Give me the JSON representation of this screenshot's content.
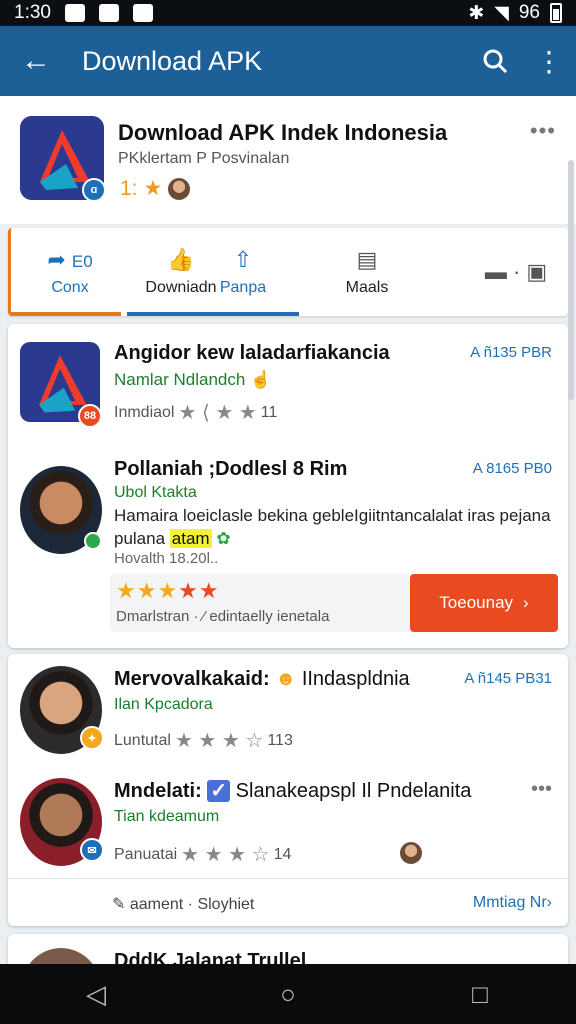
{
  "status": {
    "time": "1:30",
    "battery": "96"
  },
  "appbar": {
    "title": "Download APK"
  },
  "app": {
    "name": "Download APK Indek Indonesia",
    "subtitle": "PKklertam P Posvinalan",
    "rating": "1:",
    "more": "•••"
  },
  "tabs": [
    {
      "icon": "⇢ ⬳",
      "label_top": "E0",
      "label": "Conx"
    },
    {
      "icon": "👍",
      "label": "Downiadn"
    },
    {
      "icon": "⇧",
      "label": "Panpa"
    },
    {
      "icon": "▤",
      "label": "Maals"
    },
    {
      "icon": "▬ · ▣",
      "label": ""
    }
  ],
  "card1": {
    "item1": {
      "title": "Angidor kew laladarfiakancia",
      "sub": "Namlar Ndlandch",
      "meta": "Inmdiaol",
      "count": "11",
      "price": "A ñ135 PBR"
    },
    "item2": {
      "title": "Pollaniah ;Dodlesl 8 Rim",
      "sub": "Ubol Ktakta",
      "body": "Hamaira loeiclasle bekina gebleIgiitntancalalat iras pejana pulana",
      "highlight": "atam",
      "timestamp": "Hovalth 18.20l..",
      "price": "A 8165 PB0",
      "stars": "★★★★★",
      "footer": "Dmarlstran · ⁄ edintaelly ienetala",
      "cta": "Toeounay"
    }
  },
  "card2": {
    "item1": {
      "title": "Mervovalkakaid:",
      "title2": "IIndaspldnia",
      "sub": "Ilan Kpcadora",
      "meta": "Luntutal",
      "count": "113",
      "price": "A ñ145 PB31"
    },
    "item2": {
      "title": "Mndelati:",
      "title2": "Slanakeapspl Il Pndelanita",
      "sub": "Tian kdeamum",
      "meta": "Panuatai",
      "count": "14",
      "more": "•••"
    },
    "footer": {
      "left": "aament · Sloyhiet",
      "right": "Mmtiag Nr›"
    }
  },
  "card3": {
    "title": "DddK Jalanat Trullel"
  },
  "colors": {
    "appbar": "#1d5f97",
    "accent": "#1d70b8",
    "cta": "#ea4a1f",
    "tab_accent": "#e07b1c"
  }
}
